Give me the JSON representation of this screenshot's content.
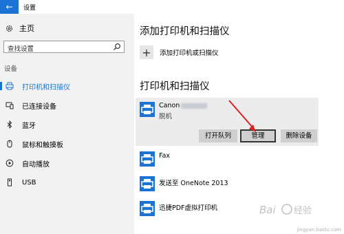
{
  "window": {
    "title": "设置"
  },
  "sidebar": {
    "home_label": "主页",
    "search_placeholder": "查找设置",
    "section_label": "设备",
    "items": [
      {
        "label": "打印机和扫描仪",
        "icon": "printer-icon",
        "active": true
      },
      {
        "label": "已连接设备",
        "icon": "connected-devices-icon",
        "active": false
      },
      {
        "label": "蓝牙",
        "icon": "bluetooth-icon",
        "active": false
      },
      {
        "label": "鼠标和触摸板",
        "icon": "mouse-icon",
        "active": false
      },
      {
        "label": "自动播放",
        "icon": "autoplay-icon",
        "active": false
      },
      {
        "label": "USB",
        "icon": "usb-icon",
        "active": false
      }
    ]
  },
  "main": {
    "add_heading": "添加打印机和扫描仪",
    "add_label": "添加打印机或扫描仪",
    "list_heading": "打印机和扫描仪",
    "printers": [
      {
        "name": "Canon",
        "status": "脱机",
        "selected": true
      },
      {
        "name": "Fax"
      },
      {
        "name": "发送至 OneNote 2013"
      },
      {
        "name": "迅捷PDF虚拟打印机"
      }
    ],
    "actions": {
      "open_queue": "打开队列",
      "manage": "管理",
      "remove": "删除设备"
    }
  },
  "watermark": {
    "text": "jingyan.baidu.com"
  },
  "colors": {
    "accent": "#1b73d6",
    "sidebar_bg": "#f2f2f2",
    "arrow": "#e02020"
  }
}
